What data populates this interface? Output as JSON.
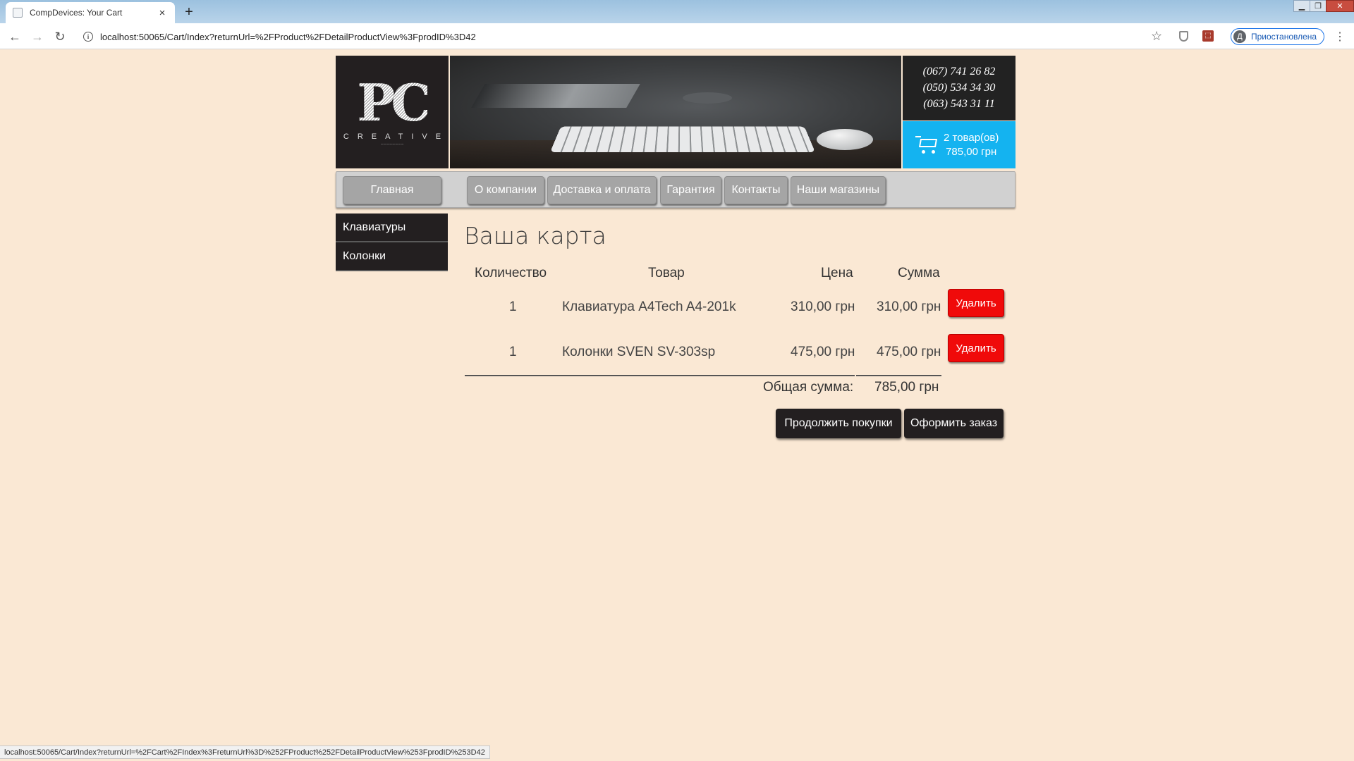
{
  "browser": {
    "tab_title": "CompDevices: Your Cart",
    "tab_close": "×",
    "new_tab": "+",
    "url": "localhost:50065/Cart/Index?returnUrl=%2FProduct%2FDetailProductView%3FprodID%3D42",
    "info_glyph": "i",
    "profile_initial": "Д",
    "profile_label": "Приостановлена",
    "back": "←",
    "forward": "→",
    "reload": "↻",
    "star": "☆",
    "menu": "⋮",
    "status_url": "localhost:50065/Cart/Index?returnUrl=%2FCart%2FIndex%3FreturnUrl%3D%252FProduct%252FDetailProductView%253FprodID%253D42"
  },
  "header": {
    "logo_mark": "PC",
    "logo_word": "CREATIVE",
    "phones": [
      "(067) 741 26 82",
      "(050) 534 34 30",
      "(063) 543 31 11"
    ],
    "cart_summary": {
      "items": "2 товар(ов)",
      "total": "785,00 грн"
    }
  },
  "nav": {
    "home": "Главная",
    "about": "О компании",
    "delivery": "Доставка и оплата",
    "warranty": "Гарантия",
    "contacts": "Контакты",
    "stores": "Наши магазины"
  },
  "sidebar": {
    "items": [
      {
        "label": "Клавиатуры"
      },
      {
        "label": "Колонки"
      }
    ]
  },
  "cart": {
    "title": "Ваша карта",
    "columns": {
      "quantity": "Количество",
      "product": "Товар",
      "price": "Цена",
      "sum": "Сумма"
    },
    "rows": [
      {
        "quantity": "1",
        "product": "Клавиатура A4Tech A4-201k",
        "price": "310,00 грн",
        "sum": "310,00 грн",
        "remove": "Удалить"
      },
      {
        "quantity": "1",
        "product": "Колонки SVEN SV-303sp",
        "price": "475,00 грн",
        "sum": "475,00 грн",
        "remove": "Удалить"
      }
    ],
    "total_label": "Общая сумма:",
    "total_value": "785,00 грн",
    "continue_button": "Продолжить покупки",
    "checkout_button": "Оформить заказ"
  }
}
